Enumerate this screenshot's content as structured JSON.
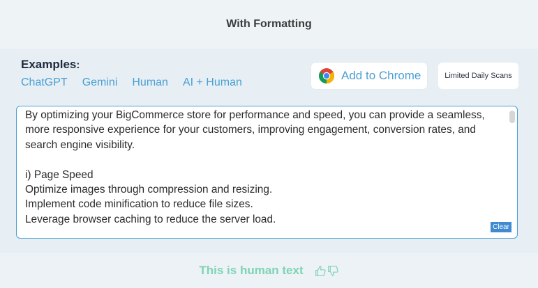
{
  "header": {
    "title": "With Formatting"
  },
  "examples": {
    "label": "Examples",
    "colon": ":",
    "items": [
      {
        "label": "ChatGPT"
      },
      {
        "label": "Gemini"
      },
      {
        "label": "Human"
      },
      {
        "label": "AI + Human"
      }
    ]
  },
  "actions": {
    "chrome_label": "Add to Chrome",
    "chrome_icon": "chrome-icon",
    "limited_label": "Limited Daily Scans"
  },
  "editor": {
    "text": "By optimizing your BigCommerce store for performance and speed, you can provide a seamless, more responsive experience for your customers, improving engagement, conversion rates, and search engine visibility.\n\ni) Page Speed\nOptimize images through compression and resizing.\nImplement code minification to reduce file sizes.\nLeverage browser caching to reduce the server load.",
    "clear_label": "Clear"
  },
  "result": {
    "text": "This is human text",
    "thumbs_up_icon": "thumbs-up-icon",
    "thumbs_down_icon": "thumbs-down-icon"
  },
  "colors": {
    "accent": "#4a9fd4",
    "result": "#7fd3b5",
    "clear_bg": "#3f8ad0"
  }
}
